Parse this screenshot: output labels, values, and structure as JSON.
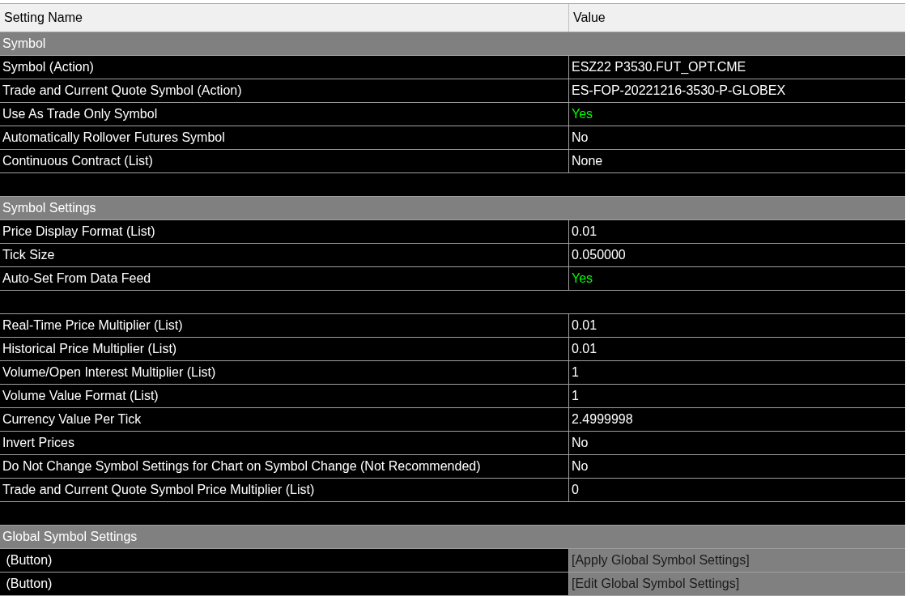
{
  "columns": [
    "Setting Name",
    "Value"
  ],
  "rows": [
    {
      "kind": "section",
      "name": "Symbol"
    },
    {
      "kind": "setting",
      "name": "Symbol (Action)",
      "value": "ESZ22 P3530.FUT_OPT.CME",
      "highlighted": false
    },
    {
      "kind": "setting",
      "name": "Trade and Current Quote Symbol (Action)",
      "value": "ES-FOP-20221216-3530-P-GLOBEX",
      "highlighted": false
    },
    {
      "kind": "setting",
      "name": "Use As Trade Only Symbol",
      "value": "Yes",
      "highlighted": true
    },
    {
      "kind": "setting",
      "name": "Automatically Rollover Futures Symbol",
      "value": "No",
      "highlighted": false
    },
    {
      "kind": "setting",
      "name": "Continuous Contract (List)",
      "value": "None",
      "highlighted": false
    },
    {
      "kind": "blank"
    },
    {
      "kind": "section",
      "name": "Symbol Settings"
    },
    {
      "kind": "setting",
      "name": "Price Display Format (List)",
      "value": "0.01",
      "highlighted": false
    },
    {
      "kind": "setting",
      "name": "Tick Size",
      "value": "0.050000",
      "highlighted": false
    },
    {
      "kind": "setting",
      "name": "Auto-Set From Data Feed",
      "value": "Yes",
      "highlighted": true
    },
    {
      "kind": "blank"
    },
    {
      "kind": "setting",
      "name": "Real-Time Price Multiplier (List)",
      "value": "0.01",
      "highlighted": false
    },
    {
      "kind": "setting",
      "name": "Historical Price Multiplier (List)",
      "value": "0.01",
      "highlighted": false
    },
    {
      "kind": "setting",
      "name": "Volume/Open Interest Multiplier (List)",
      "value": "1",
      "highlighted": false
    },
    {
      "kind": "setting",
      "name": "Volume Value Format (List)",
      "value": "1",
      "highlighted": false
    },
    {
      "kind": "setting",
      "name": "Currency Value Per Tick",
      "value": "2.4999998",
      "highlighted": false
    },
    {
      "kind": "setting",
      "name": "Invert Prices",
      "value": "No",
      "highlighted": false
    },
    {
      "kind": "setting",
      "name": "Do Not Change Symbol Settings for Chart on Symbol Change (Not Recommended)",
      "value": "No",
      "highlighted": false
    },
    {
      "kind": "setting",
      "name": "Trade and Current Quote Symbol Price Multiplier (List)",
      "value": "0",
      "highlighted": false
    },
    {
      "kind": "blank"
    },
    {
      "kind": "section",
      "name": "Global Symbol Settings"
    },
    {
      "kind": "button",
      "name": " (Button)",
      "value": "[Apply Global Symbol Settings]"
    },
    {
      "kind": "button",
      "name": " (Button)",
      "value": "[Edit Global Symbol Settings]"
    }
  ]
}
